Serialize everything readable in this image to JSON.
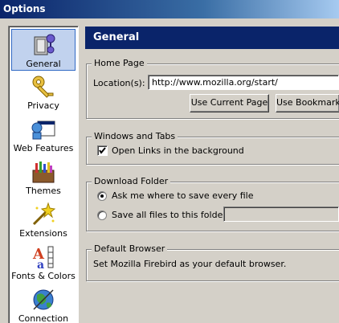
{
  "window": {
    "title": "Options"
  },
  "sidebar": {
    "items": [
      {
        "label": "General",
        "icon": "general-icon",
        "selected": true
      },
      {
        "label": "Privacy",
        "icon": "key-icon"
      },
      {
        "label": "Web Features",
        "icon": "web-features-icon"
      },
      {
        "label": "Themes",
        "icon": "themes-icon"
      },
      {
        "label": "Extensions",
        "icon": "extensions-icon"
      },
      {
        "label": "Fonts & Colors",
        "icon": "fonts-colors-icon"
      },
      {
        "label": "Connection",
        "icon": "connection-icon"
      }
    ]
  },
  "panel": {
    "title": "General"
  },
  "home_page": {
    "group_title": "Home Page",
    "location_label": "Location(s):",
    "location_value": "http://www.mozilla.org/start/",
    "use_current_page": "Use Current Page",
    "use_bookmark": "Use Bookmark..."
  },
  "windows_tabs": {
    "group_title": "Windows and Tabs",
    "open_links_label": "Open Links in the background",
    "open_links_checked": true
  },
  "download": {
    "group_title": "Download Folder",
    "ask_label": "Ask me where to save every file",
    "save_all_label": "Save all files to this folder:",
    "selected": "ask"
  },
  "default_browser": {
    "group_title": "Default Browser",
    "text": "Set Mozilla Firebird as your default browser."
  }
}
